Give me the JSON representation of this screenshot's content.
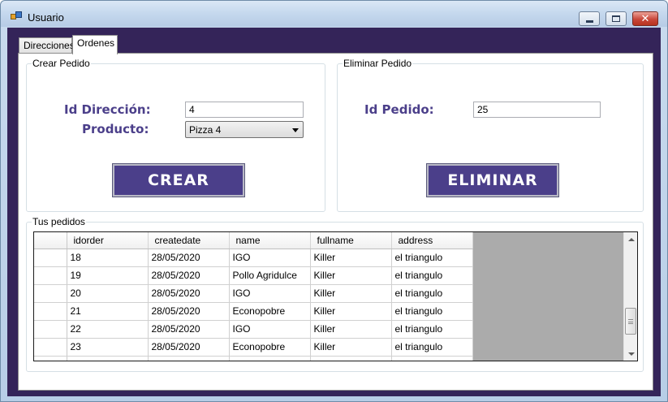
{
  "window": {
    "title": "Usuario",
    "icon": "app-icon"
  },
  "tabs": [
    {
      "label": "Direcciones",
      "selected": false
    },
    {
      "label": "Ordenes",
      "selected": true
    }
  ],
  "crear_pedido": {
    "legend": "Crear Pedido",
    "id_direccion_label": "Id Dirección:",
    "id_direccion_value": "4",
    "producto_label": "Producto:",
    "producto_selected": "Pizza 4",
    "button_label": "CREAR"
  },
  "eliminar_pedido": {
    "legend": "Eliminar Pedido",
    "id_pedido_label": "Id Pedido:",
    "id_pedido_value": "25",
    "button_label": "ELIMINAR"
  },
  "tus_pedidos": {
    "legend": "Tus pedidos",
    "columns": [
      "idorder",
      "createdate",
      "name",
      "fullname",
      "address"
    ],
    "rows": [
      [
        "18",
        "28/05/2020",
        "IGO",
        "Killer",
        "el triangulo"
      ],
      [
        "19",
        "28/05/2020",
        "Pollo Agridulce",
        "Killer",
        "el triangulo"
      ],
      [
        "20",
        "28/05/2020",
        "IGO",
        "Killer",
        "el triangulo"
      ],
      [
        "21",
        "28/05/2020",
        "Econopobre",
        "Killer",
        "el triangulo"
      ],
      [
        "22",
        "28/05/2020",
        "IGO",
        "Killer",
        "el triangulo"
      ],
      [
        "23",
        "28/05/2020",
        "Econopobre",
        "Killer",
        "el triangulo"
      ]
    ]
  },
  "colors": {
    "client_background": "#342459",
    "accent": "#4b3f8a",
    "grid_background": "#ababab"
  }
}
